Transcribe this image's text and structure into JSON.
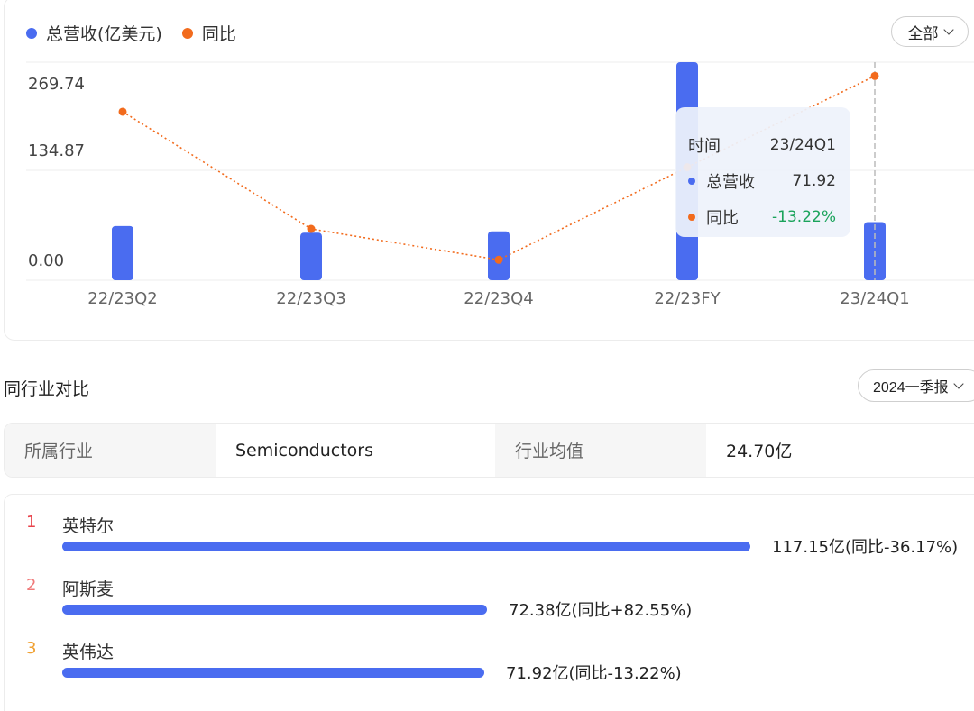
{
  "legend": [
    {
      "label": "总营收(亿美元)",
      "color": "#4a6cf0"
    },
    {
      "label": "同比",
      "color": "#f26b1d"
    }
  ],
  "range_button": {
    "label": "全部"
  },
  "chart_data": {
    "type": "bar",
    "categories": [
      "22/23Q2",
      "22/23Q3",
      "22/23Q4",
      "22/23FY",
      "23/24Q1"
    ],
    "series": [
      {
        "name": "总营收(亿美元)",
        "type": "bar",
        "values": [
          67.04,
          58.82,
          60.51,
          269.74,
          71.92
        ]
      },
      {
        "name": "同比",
        "type": "line",
        "values": [
          -19.0,
          -38.0,
          -43.0,
          -28.0,
          -13.22
        ]
      }
    ],
    "y_ticks": [
      "269.74",
      "134.87",
      "0.00"
    ],
    "ylim": [
      0,
      269.74
    ],
    "grid": true,
    "highlight_index": 4
  },
  "tooltip": {
    "time_label": "时间",
    "time_value": "23/24Q1",
    "revenue_label": "总营收",
    "revenue_value": "71.92",
    "yoy_label": "同比",
    "yoy_value": "-13.22%"
  },
  "industry": {
    "section_title": "同行业对比",
    "period_label": "2024一季报",
    "industry_label": "所属行业",
    "industry_value": "Semiconductors",
    "avg_label": "行业均值",
    "avg_value": "24.70亿"
  },
  "ranking": [
    {
      "rank": "1",
      "rank_color": "#e8424a",
      "name": "英特尔",
      "value": 117.15,
      "value_text": "117.15亿(同比-36.17%)"
    },
    {
      "rank": "2",
      "rank_color": "#f07a7a",
      "name": "阿斯麦",
      "value": 72.38,
      "value_text": "72.38亿(同比+82.55%)"
    },
    {
      "rank": "3",
      "rank_color": "#f0a030",
      "name": "英伟达",
      "value": 71.92,
      "value_text": "71.92亿(同比-13.22%)"
    }
  ]
}
